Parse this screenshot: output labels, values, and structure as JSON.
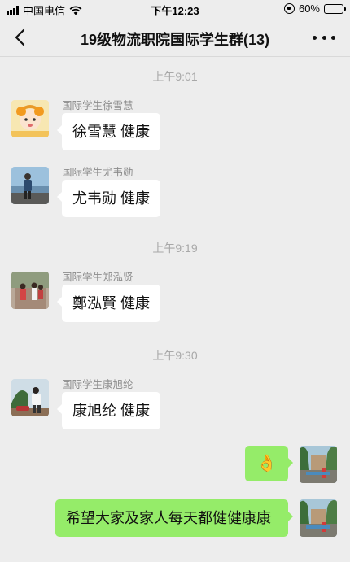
{
  "status_bar": {
    "carrier": "中国电信",
    "time": "下午12:23",
    "battery": "60%",
    "battery_level": 0.6
  },
  "nav": {
    "title": "19级物流职院国际学生群(13)",
    "back_icon": "chevron-left-icon",
    "more_icon": "more-dots-icon"
  },
  "chat": {
    "timestamps": [
      "上午9:01",
      "上午9:19",
      "上午9:30"
    ],
    "messages": [
      {
        "sender": "国际学生徐雪慧",
        "text": "徐雪慧 健康"
      },
      {
        "sender": "国际学生尤韦勋",
        "text": "尤韦勋 健康"
      },
      {
        "sender": "国际学生郑泓贤",
        "text": "鄭泓賢 健康"
      },
      {
        "sender": "国际学生康旭纶",
        "text": "康旭纶 健康"
      },
      {
        "sender": "",
        "text": "👌"
      },
      {
        "sender": "",
        "text": "希望大家及家人每天都健健康康"
      }
    ]
  },
  "colors": {
    "background": "#ededed",
    "incoming_bubble": "#ffffff",
    "outgoing_bubble": "#95ec69",
    "timestamp": "#a8a8a8"
  }
}
